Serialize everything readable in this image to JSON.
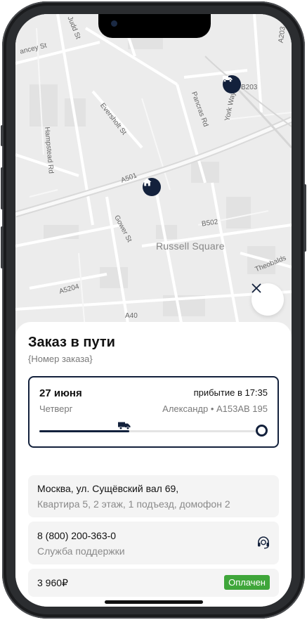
{
  "map": {
    "labels": [
      "ancey St",
      "Judd St",
      "Hampstead Rd",
      "Eversholt St",
      "Pancras Rd",
      "York Way",
      "B203",
      "A501",
      "Gower St",
      "B502",
      "Russell Square",
      "Theobalds",
      "A5204",
      "A40",
      "A203"
    ],
    "pins": {
      "truck": "truck-icon",
      "home": "home-icon"
    },
    "close_icon": "close-icon"
  },
  "order": {
    "title": "Заказ в пути",
    "number_placeholder": "{Номер заказа}"
  },
  "delivery": {
    "date": "27 июня",
    "arrival": "прибытие в 17:35",
    "weekday": "Четверг",
    "courier": "Александр • А153АВ 195",
    "progress": 0.41
  },
  "address": {
    "line1": "Москва, ул. Сущёвский вал 69,",
    "line2": "Квартира 5, 2 этаж, 1 подъезд, домофон 2"
  },
  "support": {
    "phone": "8 (800) 200-363-0",
    "label": "Служба поддержки",
    "icon": "headset-icon"
  },
  "payment": {
    "amount": "3 960₽",
    "status": "Оплачен"
  },
  "colors": {
    "accent": "#13213c",
    "paid": "#3fa63a"
  }
}
